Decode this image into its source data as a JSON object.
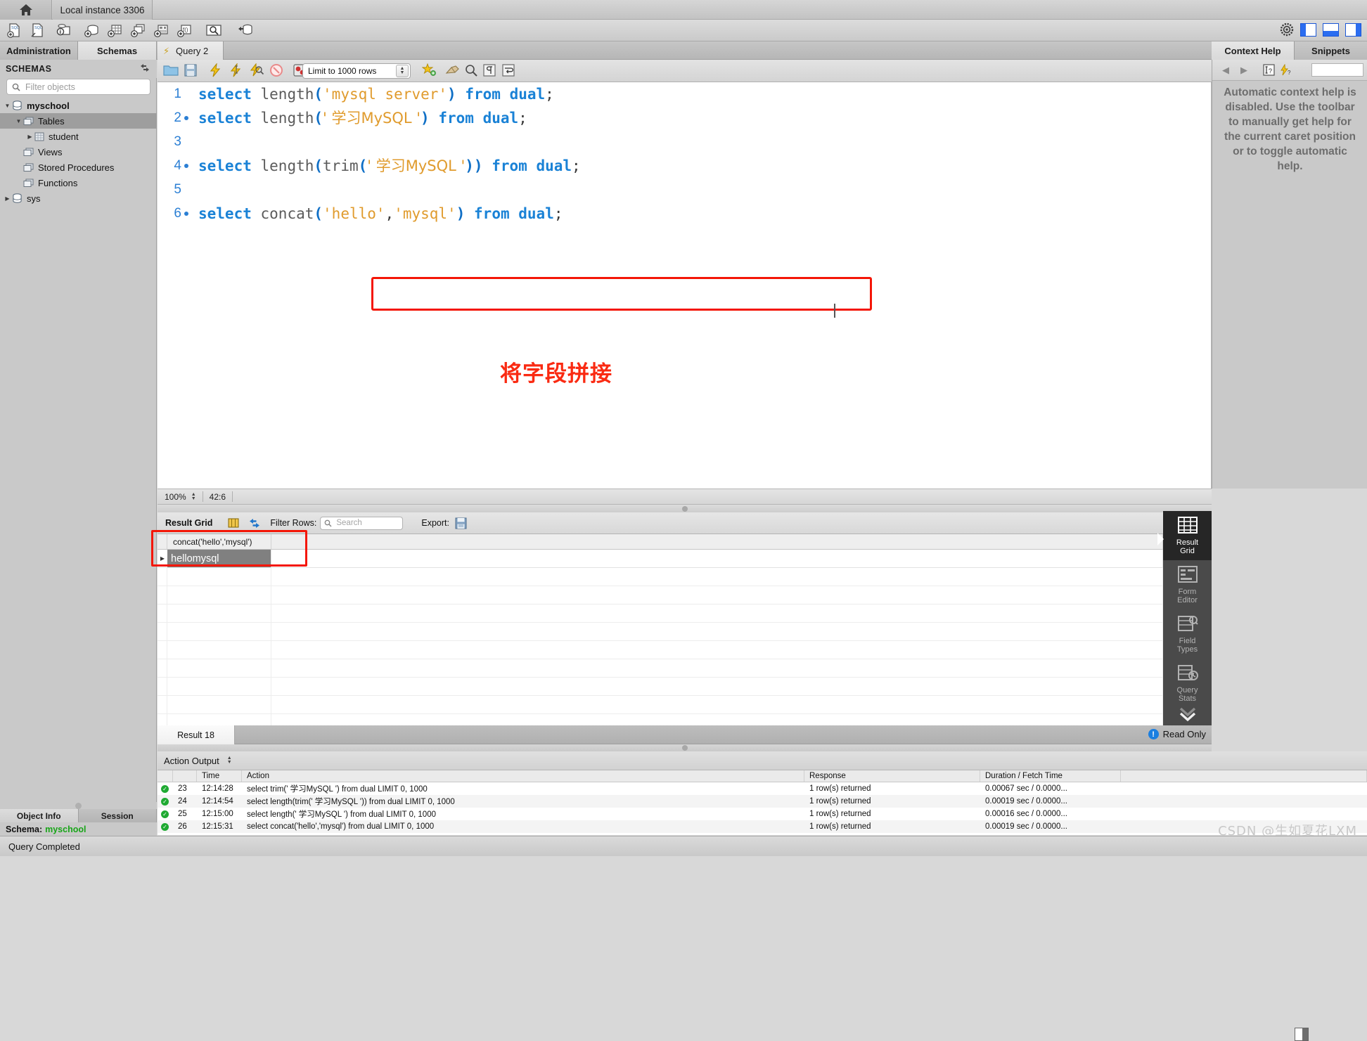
{
  "titlebar": {
    "home_icon": "home-icon",
    "instance_tab": "Local instance 3306"
  },
  "main_toolbar": {
    "icons": [
      "new-sql-tab-icon",
      "open-sql-script-icon",
      "connection-info-icon",
      "new-schema-icon",
      "new-table-icon",
      "new-view-icon",
      "new-procedure-icon",
      "new-function-icon",
      "search-data-icon",
      "reconnect-icon"
    ],
    "right_icons": [
      "gear-icon",
      "toggle-left-panel-icon",
      "toggle-bottom-panel-icon",
      "toggle-right-panel-icon"
    ]
  },
  "tabs": {
    "administration": "Administration",
    "schemas": "Schemas",
    "query": "Query 2",
    "context_help": "Context Help",
    "snippets": "Snippets"
  },
  "sidebar": {
    "title": "SCHEMAS",
    "filter_placeholder": "Filter objects",
    "filter_value": "",
    "tree": [
      {
        "label": "myschool",
        "level": 0,
        "icon": "database-icon",
        "expanded": true,
        "selected": false,
        "bold": true
      },
      {
        "label": "Tables",
        "level": 1,
        "icon": "folder-icon",
        "expanded": true,
        "selected": true,
        "bold": false
      },
      {
        "label": "student",
        "level": 2,
        "icon": "table-icon",
        "expanded": false,
        "selected": false,
        "bold": false
      },
      {
        "label": "Views",
        "level": 1,
        "icon": "folder-icon",
        "expanded": null,
        "selected": false,
        "bold": false
      },
      {
        "label": "Stored Procedures",
        "level": 1,
        "icon": "folder-icon",
        "expanded": null,
        "selected": false,
        "bold": false
      },
      {
        "label": "Functions",
        "level": 1,
        "icon": "folder-icon",
        "expanded": null,
        "selected": false,
        "bold": false
      },
      {
        "label": "sys",
        "level": 0,
        "icon": "database-icon",
        "expanded": false,
        "selected": false,
        "bold": false
      }
    ],
    "bottom_tabs": {
      "object_info": "Object Info",
      "session": "Session"
    },
    "object_info": {
      "label": "Schema:",
      "value": "myschool"
    }
  },
  "editor_toolbar": {
    "icons": [
      "open-file-icon",
      "save-file-icon",
      "execute-icon",
      "execute-current-icon",
      "explain-icon",
      "stop-icon",
      "toggle-stop-on-error-icon",
      "commit-icon",
      "rollback-icon",
      "autocommit-icon",
      "beautify-icon",
      "find-icon",
      "invisible-chars-icon",
      "wrap-lines-icon"
    ],
    "limit_label": "Limit to 1000 rows"
  },
  "editor": {
    "lines": [
      {
        "num": "1",
        "exec_marker": false,
        "tokens": [
          {
            "t": "select",
            "c": "kw"
          },
          {
            "t": " ",
            "c": "pun"
          },
          {
            "t": "length",
            "c": "fn"
          },
          {
            "t": "(",
            "c": "pn"
          },
          {
            "t": "'mysql server'",
            "c": "str"
          },
          {
            "t": ")",
            "c": "pn"
          },
          {
            "t": " ",
            "c": "pun"
          },
          {
            "t": "from",
            "c": "kw"
          },
          {
            "t": " ",
            "c": "pun"
          },
          {
            "t": "dual",
            "c": "kw"
          },
          {
            "t": ";",
            "c": "pun"
          }
        ]
      },
      {
        "num": "2",
        "exec_marker": true,
        "tokens": [
          {
            "t": "select",
            "c": "kw"
          },
          {
            "t": " ",
            "c": "pun"
          },
          {
            "t": "length",
            "c": "fn"
          },
          {
            "t": "(",
            "c": "pn"
          },
          {
            "t": "' 学习MySQL '",
            "c": "str"
          },
          {
            "t": ")",
            "c": "pn"
          },
          {
            "t": " ",
            "c": "pun"
          },
          {
            "t": "from",
            "c": "kw"
          },
          {
            "t": " ",
            "c": "pun"
          },
          {
            "t": "dual",
            "c": "kw"
          },
          {
            "t": ";",
            "c": "pun"
          }
        ]
      },
      {
        "num": "3",
        "exec_marker": false,
        "tokens": []
      },
      {
        "num": "4",
        "exec_marker": true,
        "tokens": [
          {
            "t": "select",
            "c": "kw"
          },
          {
            "t": " ",
            "c": "pun"
          },
          {
            "t": "length",
            "c": "fn"
          },
          {
            "t": "(",
            "c": "pn"
          },
          {
            "t": "trim",
            "c": "fn"
          },
          {
            "t": "(",
            "c": "pn"
          },
          {
            "t": "' 学习MySQL '",
            "c": "str"
          },
          {
            "t": "))",
            "c": "pn"
          },
          {
            "t": " ",
            "c": "pun"
          },
          {
            "t": "from",
            "c": "kw"
          },
          {
            "t": " ",
            "c": "pun"
          },
          {
            "t": "dual",
            "c": "kw"
          },
          {
            "t": ";",
            "c": "pun"
          }
        ]
      },
      {
        "num": "5",
        "exec_marker": false,
        "tokens": []
      },
      {
        "num": "6",
        "exec_marker": true,
        "tokens": [
          {
            "t": "select",
            "c": "kw"
          },
          {
            "t": " ",
            "c": "pun"
          },
          {
            "t": "concat",
            "c": "fn"
          },
          {
            "t": "(",
            "c": "pn"
          },
          {
            "t": "'hello'",
            "c": "str"
          },
          {
            "t": ",",
            "c": "pun"
          },
          {
            "t": "'mysql'",
            "c": "str"
          },
          {
            "t": ")",
            "c": "pn"
          },
          {
            "t": " ",
            "c": "pun"
          },
          {
            "t": "from",
            "c": "kw"
          },
          {
            "t": " ",
            "c": "pun"
          },
          {
            "t": "dual",
            "c": "kw"
          },
          {
            "t": ";",
            "c": "pun"
          }
        ]
      }
    ],
    "annotation": "将字段拼接",
    "highlight_color": "#f41607"
  },
  "editor_status": {
    "zoom": "100%",
    "caret_position": "42:6"
  },
  "result_toolbar": {
    "title": "Result Grid",
    "filter_rows_label": "Filter Rows:",
    "search_placeholder": "Search",
    "search_value": "",
    "export_label": "Export:",
    "icons": [
      "grid-view-icon",
      "refresh-icon",
      "search-icon",
      "export-icon"
    ]
  },
  "result_grid": {
    "columns": [
      "concat('hello','mysql')"
    ],
    "rows": [
      [
        "hellomysql"
      ]
    ],
    "selected_cell": "hellomysql",
    "empty_row_count": 9
  },
  "vertical_toolbar": {
    "items": [
      {
        "label": "Result\nGrid",
        "line1": "Result",
        "line2": "Grid",
        "icon": "grid-icon",
        "selected": true
      },
      {
        "label": "Form Editor",
        "line1": "Form",
        "line2": "Editor",
        "icon": "form-icon",
        "selected": false
      },
      {
        "label": "Field Types",
        "line1": "Field",
        "line2": "Types",
        "icon": "field-types-icon",
        "selected": false
      },
      {
        "label": "Query Stats",
        "line1": "Query",
        "line2": "Stats",
        "icon": "query-stats-icon",
        "selected": false
      }
    ]
  },
  "result_tab": {
    "label": "Result 18",
    "read_only": "Read Only"
  },
  "action_output": {
    "title": "Action Output",
    "columns": [
      "",
      "",
      "Time",
      "Action",
      "Response",
      "Duration / Fetch Time"
    ],
    "rows": [
      {
        "status": "ok",
        "num": "23",
        "time": "12:14:28",
        "action": "select trim(' 学习MySQL ') from dual LIMIT 0, 1000",
        "response": "1 row(s) returned",
        "duration": "0.00067 sec / 0.0000..."
      },
      {
        "status": "ok",
        "num": "24",
        "time": "12:14:54",
        "action": "select length(trim(' 学习MySQL ')) from dual LIMIT 0, 1000",
        "response": "1 row(s) returned",
        "duration": "0.00019 sec / 0.0000..."
      },
      {
        "status": "ok",
        "num": "25",
        "time": "12:15:00",
        "action": "select length(' 学习MySQL ') from dual LIMIT 0, 1000",
        "response": "1 row(s) returned",
        "duration": "0.00016 sec / 0.0000..."
      },
      {
        "status": "ok",
        "num": "26",
        "time": "12:15:31",
        "action": "select concat('hello','mysql') from dual LIMIT 0, 1000",
        "response": "1 row(s) returned",
        "duration": "0.00019 sec / 0.0000..."
      }
    ]
  },
  "context_help": {
    "body": "Automatic context help is disabled. Use the toolbar to manually get help for the current caret position or to toggle automatic help.",
    "search_value": "",
    "icons": [
      "back-arrow-icon",
      "forward-arrow-icon",
      "context-help-icon",
      "auto-help-toggle-icon"
    ]
  },
  "statusbar": {
    "message": "Query Completed"
  },
  "watermark": "CSDN @生如夏花LXM"
}
